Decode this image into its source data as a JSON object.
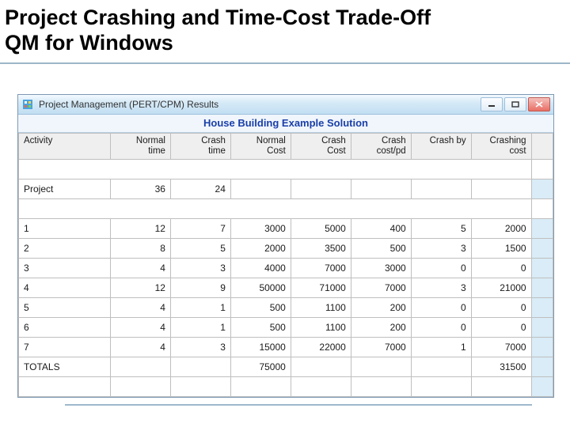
{
  "slide": {
    "title_line1": "Project Crashing and Time-Cost Trade-Off",
    "title_line2": "QM for Windows"
  },
  "window": {
    "title": "Project Management (PERT/CPM) Results",
    "subtitle": "House Building Example Solution"
  },
  "columns": {
    "activity": "Activity",
    "normal_time": "Normal\ntime",
    "crash_time": "Crash\ntime",
    "normal_cost": "Normal\nCost",
    "crash_cost": "Crash\nCost",
    "crash_cost_pd": "Crash\ncost/pd",
    "crash_by": "Crash by",
    "crashing_cost": "Crashing\ncost"
  },
  "project": {
    "label": "Project",
    "normal_time": "36",
    "crash_time": "24"
  },
  "rows": [
    {
      "activity": "1",
      "normal_time": "12",
      "crash_time": "7",
      "normal_cost": "3000",
      "crash_cost": "5000",
      "crash_cost_pd": "400",
      "crash_by": "5",
      "crashing_cost": "2000"
    },
    {
      "activity": "2",
      "normal_time": "8",
      "crash_time": "5",
      "normal_cost": "2000",
      "crash_cost": "3500",
      "crash_cost_pd": "500",
      "crash_by": "3",
      "crashing_cost": "1500"
    },
    {
      "activity": "3",
      "normal_time": "4",
      "crash_time": "3",
      "normal_cost": "4000",
      "crash_cost": "7000",
      "crash_cost_pd": "3000",
      "crash_by": "0",
      "crashing_cost": "0"
    },
    {
      "activity": "4",
      "normal_time": "12",
      "crash_time": "9",
      "normal_cost": "50000",
      "crash_cost": "71000",
      "crash_cost_pd": "7000",
      "crash_by": "3",
      "crashing_cost": "21000"
    },
    {
      "activity": "5",
      "normal_time": "4",
      "crash_time": "1",
      "normal_cost": "500",
      "crash_cost": "1100",
      "crash_cost_pd": "200",
      "crash_by": "0",
      "crashing_cost": "0"
    },
    {
      "activity": "6",
      "normal_time": "4",
      "crash_time": "1",
      "normal_cost": "500",
      "crash_cost": "1100",
      "crash_cost_pd": "200",
      "crash_by": "0",
      "crashing_cost": "0"
    },
    {
      "activity": "7",
      "normal_time": "4",
      "crash_time": "3",
      "normal_cost": "15000",
      "crash_cost": "22000",
      "crash_cost_pd": "7000",
      "crash_by": "1",
      "crashing_cost": "7000"
    }
  ],
  "totals": {
    "label": "TOTALS",
    "normal_cost": "75000",
    "crashing_cost": "31500"
  }
}
